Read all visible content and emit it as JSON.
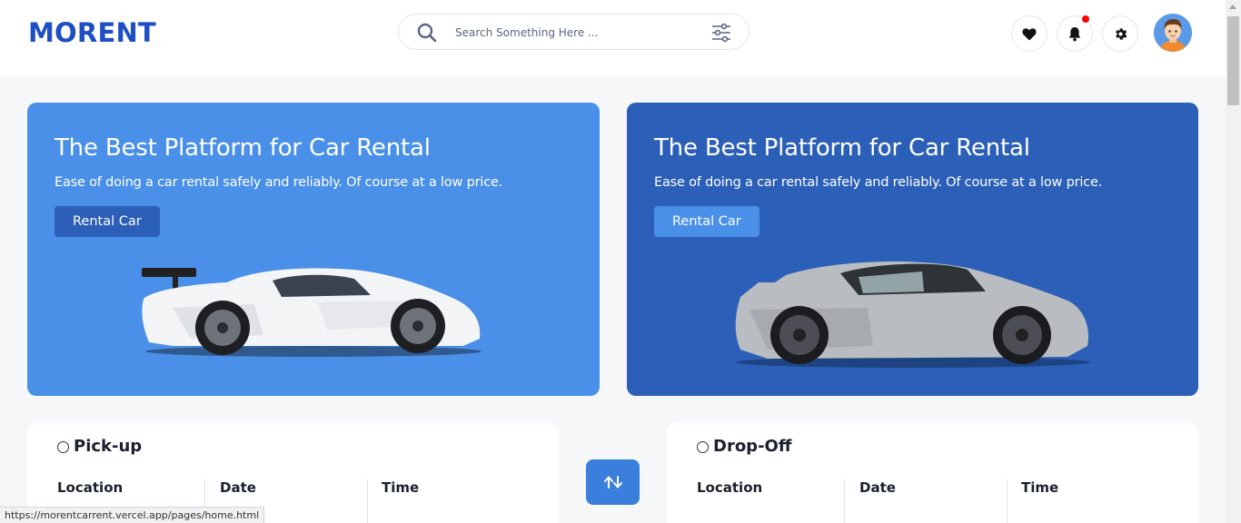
{
  "header": {
    "logo": "MORENT",
    "search_placeholder": "Search Something Here ..."
  },
  "banners": [
    {
      "title": "The Best Platform for Car Rental",
      "subtitle": "Ease of doing a car rental safely and reliably. Of course at a low price.",
      "button": "Rental Car"
    },
    {
      "title": "The Best Platform for Car Rental",
      "subtitle": "Ease of doing a car rental safely and reliably. Of course at a low price.",
      "button": "Rental Car"
    }
  ],
  "pickup": {
    "title": "Pick-up",
    "location_label": "Location",
    "date_label": "Date",
    "time_label": "Time"
  },
  "dropoff": {
    "title": "Drop-Off",
    "location_label": "Location",
    "date_label": "Date",
    "time_label": "Time"
  },
  "status_url": "https://morentcarrent.vercel.app/pages/home.html",
  "colors": {
    "brand": "#1f4fc4",
    "banner_light": "#4a90e8",
    "banner_dark": "#2b5fb8",
    "notification_dot": "#ff0000"
  }
}
